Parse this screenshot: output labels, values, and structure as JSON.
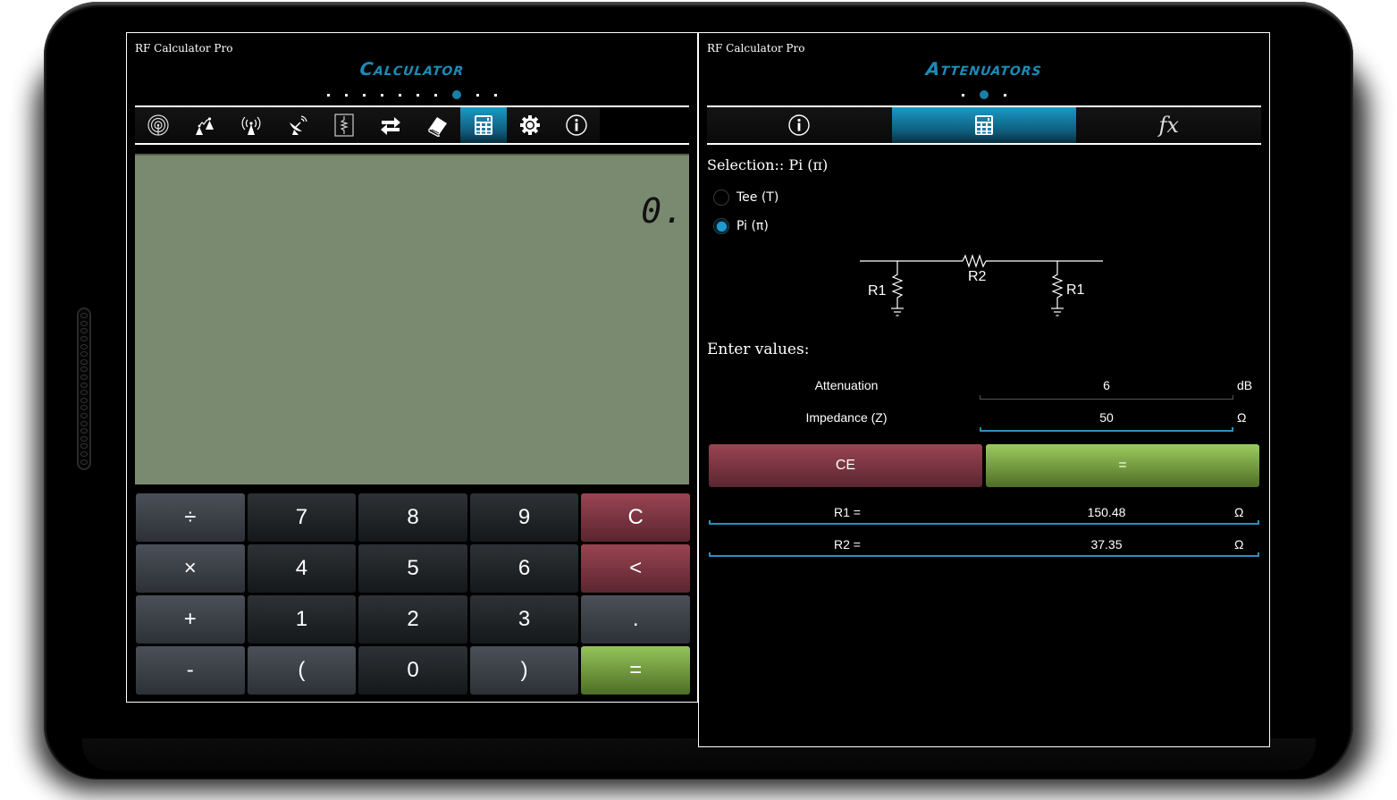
{
  "left_panel": {
    "app_name": "RF Calculator Pro",
    "title": "Calculator",
    "page_dots": {
      "count": 10,
      "active_index": 7
    },
    "tabs": [
      {
        "icon": "radar-icon",
        "active": false
      },
      {
        "icon": "mountain-link-icon",
        "active": false
      },
      {
        "icon": "antenna-tower-icon",
        "active": false
      },
      {
        "icon": "satellite-dish-icon",
        "active": false
      },
      {
        "icon": "resistor-icon",
        "active": false
      },
      {
        "icon": "convert-arrows-icon",
        "active": false
      },
      {
        "icon": "book-icon",
        "active": false
      },
      {
        "icon": "calculator-icon",
        "active": true
      },
      {
        "icon": "gear-icon",
        "active": false
      },
      {
        "icon": "info-icon",
        "active": false
      }
    ],
    "display_value": "0.",
    "keypad": [
      {
        "label": "÷",
        "style": "op"
      },
      {
        "label": "7",
        "style": "num"
      },
      {
        "label": "8",
        "style": "num"
      },
      {
        "label": "9",
        "style": "num"
      },
      {
        "label": "C",
        "style": "red"
      },
      {
        "label": "×",
        "style": "op"
      },
      {
        "label": "4",
        "style": "num"
      },
      {
        "label": "5",
        "style": "num"
      },
      {
        "label": "6",
        "style": "num"
      },
      {
        "label": "<",
        "style": "red"
      },
      {
        "label": "+",
        "style": "op"
      },
      {
        "label": "1",
        "style": "num"
      },
      {
        "label": "2",
        "style": "num"
      },
      {
        "label": "3",
        "style": "num"
      },
      {
        "label": ".",
        "style": "op"
      },
      {
        "label": "-",
        "style": "op"
      },
      {
        "label": "(",
        "style": "op"
      },
      {
        "label": "0",
        "style": "num"
      },
      {
        "label": ")",
        "style": "op"
      },
      {
        "label": "=",
        "style": "green"
      }
    ]
  },
  "right_panel": {
    "app_name": "RF Calculator Pro",
    "title": "Attenuators",
    "page_dots": {
      "count": 3,
      "active_index": 1
    },
    "tabs": [
      {
        "icon": "info-icon",
        "active": false
      },
      {
        "icon": "calculator-icon",
        "active": true
      },
      {
        "icon": "fx-icon",
        "label": "fx",
        "active": false
      }
    ],
    "selection_label": "Selection:: Pi (π)",
    "options": [
      {
        "label": "Tee (T)",
        "checked": false
      },
      {
        "label": "Pi (π)",
        "checked": true
      }
    ],
    "circuit_labels": {
      "r1_left": "R1",
      "r2": "R2",
      "r1_right": "R1"
    },
    "enter_values_label": "Enter values:",
    "fields": [
      {
        "label": "Attenuation",
        "value": "6",
        "unit": "dB",
        "focused": false
      },
      {
        "label": "Impedance (Z)",
        "value": "50",
        "unit": "Ω",
        "focused": true
      }
    ],
    "ce_label": "CE",
    "equals_label": "=",
    "results": [
      {
        "label": "R1 =",
        "value": "150.48",
        "unit": "Ω"
      },
      {
        "label": "R2 =",
        "value": "37.35",
        "unit": "Ω"
      }
    ]
  },
  "colors": {
    "accent_blue": "#1c8bb5",
    "lcd_green": "#7a8a70",
    "key_red": "#9a4452",
    "key_green": "#95c45a"
  }
}
